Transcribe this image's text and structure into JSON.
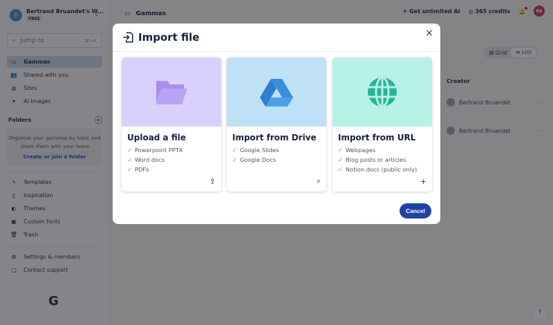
{
  "workspace": {
    "initial": "B",
    "name": "Bertrand Bruandet's W...",
    "plan": "FREE"
  },
  "search": {
    "placeholder": "Jump to",
    "shortcut": "⌘+K"
  },
  "nav": [
    {
      "label": "Gammas",
      "icon": "folder-icon"
    },
    {
      "label": "Shared with you",
      "icon": "users-icon"
    },
    {
      "label": "Sites",
      "icon": "globe-icon"
    },
    {
      "label": "AI Images",
      "icon": "sparkle-icon"
    }
  ],
  "folders": {
    "title": "Folders",
    "empty_text": "Organize your gammas by topic and share them with your team",
    "link": "Create or join a folder"
  },
  "nav2": [
    {
      "label": "Templates"
    },
    {
      "label": "Inspiration"
    },
    {
      "label": "Themes"
    },
    {
      "label": "Custom fonts"
    },
    {
      "label": "Trash"
    }
  ],
  "nav3": [
    {
      "label": "Settings & members"
    },
    {
      "label": "Contact support"
    }
  ],
  "logo": "G",
  "header": {
    "title": "Gammas",
    "upgrade": "Get unlimited AI",
    "credits": "365 credits",
    "avatar": "BB"
  },
  "view": {
    "grid": "Grid",
    "list": "List"
  },
  "table": {
    "creator_header": "Creator",
    "rows": [
      {
        "creator": "Bertrand Bruandet",
        "more": "···"
      },
      {
        "creator": "Bertrand Bruandet",
        "more": "···"
      }
    ]
  },
  "help": "?",
  "modal": {
    "title": "Import file",
    "close": "×",
    "cancel": "Cancel",
    "cards": [
      {
        "title": "Upload a file",
        "color": "#d9d0fb",
        "items": [
          "Powerpoint PPTX",
          "Word docs",
          "PDFs"
        ],
        "action": "upload-icon"
      },
      {
        "title": "Import from Drive",
        "color": "#bfe1f5",
        "items": [
          "Google Slides",
          "Google Docs"
        ],
        "action": "search-icon"
      },
      {
        "title": "Import from URL",
        "color": "#b8f2e6",
        "items": [
          "Webpages",
          "Blog posts or articles",
          "Notion docs (public only)"
        ],
        "action": "plus-icon"
      }
    ]
  }
}
